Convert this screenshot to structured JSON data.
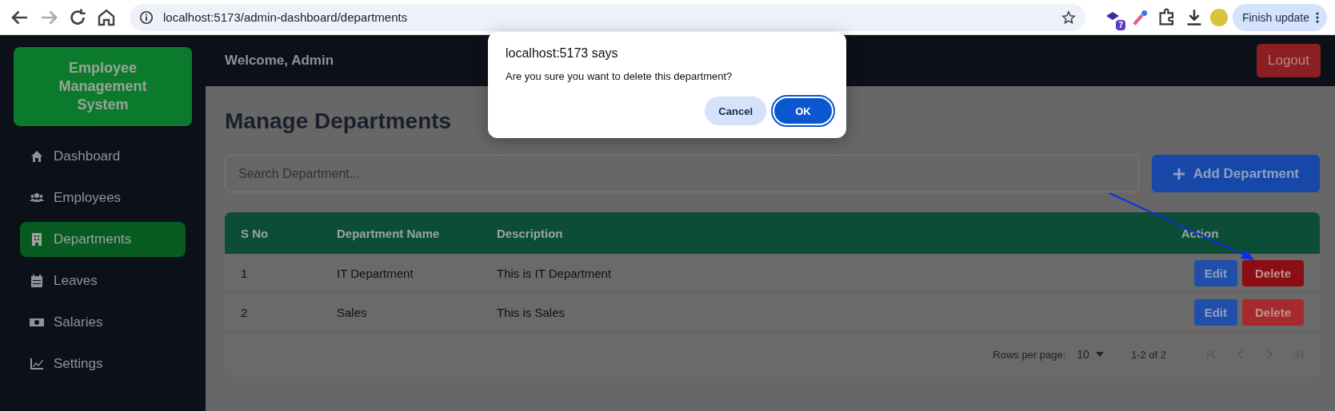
{
  "browser": {
    "url": "localhost:5173/admin-dashboard/departments",
    "extension_badge": "7",
    "update_button": "Finish update"
  },
  "sidebar": {
    "brand": "Employee Management System",
    "items": [
      {
        "label": "Dashboard",
        "selected": false
      },
      {
        "label": "Employees",
        "selected": false
      },
      {
        "label": "Departments",
        "selected": true
      },
      {
        "label": "Leaves",
        "selected": false
      },
      {
        "label": "Salaries",
        "selected": false
      },
      {
        "label": "Settings",
        "selected": false
      }
    ]
  },
  "header": {
    "welcome": "Welcome, Admin",
    "logout": "Logout"
  },
  "title": "Manage Departments",
  "search": {
    "placeholder": "Search Department..."
  },
  "add_button": "Add Department",
  "table": {
    "columns": [
      "S No",
      "Department Name",
      "Description",
      "Action"
    ],
    "rows": [
      {
        "cells": [
          "1",
          "IT Department",
          "This is IT Department"
        ],
        "edit": "Edit",
        "delete": "Delete",
        "hovered": true
      },
      {
        "cells": [
          "2",
          "Sales",
          "This is Sales"
        ],
        "edit": "Edit",
        "delete": "Delete",
        "hovered": false
      }
    ],
    "rows_per_page_label": "Rows per page:",
    "rows_per_page": "10",
    "range": "1-2 of 2"
  },
  "dialog": {
    "title": "localhost:5173 says",
    "message": "Are you sure you want to delete this department?",
    "cancel": "Cancel",
    "ok": "OK"
  }
}
